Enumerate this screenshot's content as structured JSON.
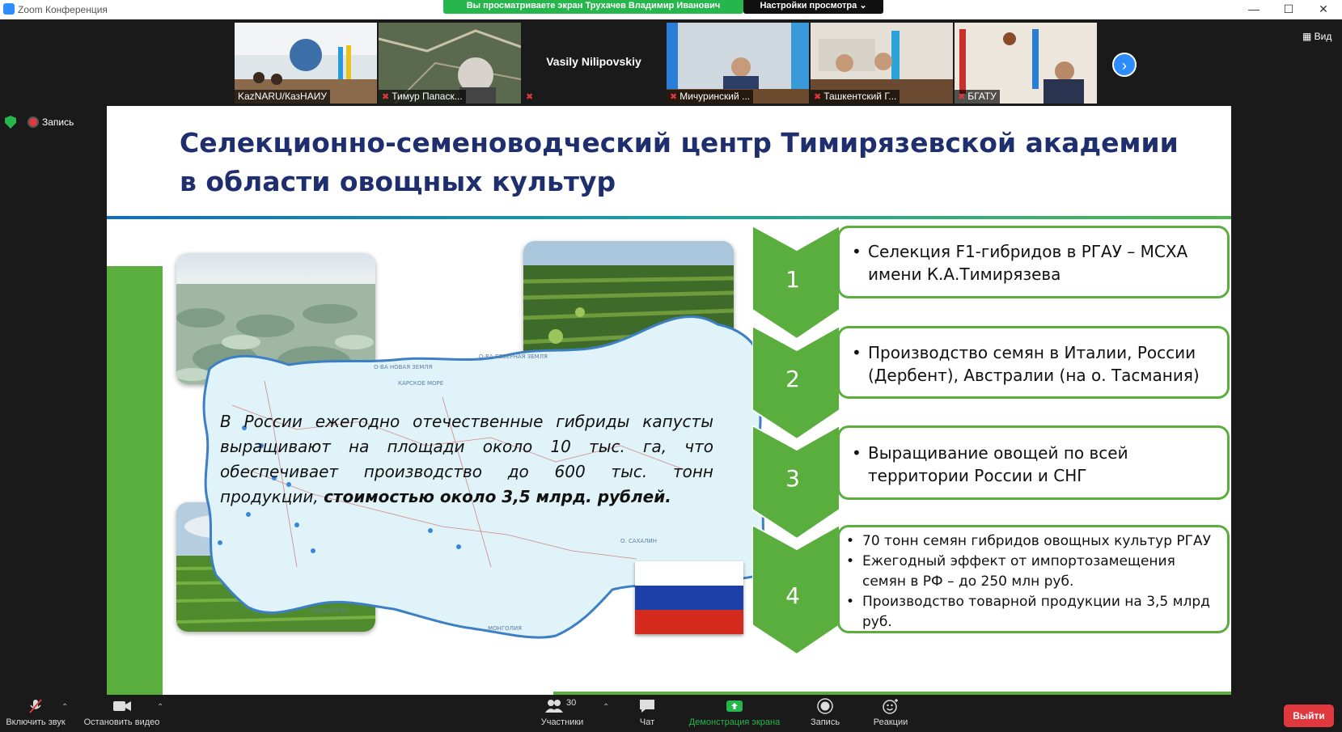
{
  "window": {
    "app_title": "Zoom Конференция",
    "minimize": "—",
    "maximize": "☐",
    "close": "✕"
  },
  "share": {
    "banner": "Вы просматриваете экран Трухачев Владимир Иванович",
    "view_options": "Настройки просмотра ⌄"
  },
  "gallery": {
    "participants": [
      {
        "name": "KazNARU/КазНАИУ",
        "muted": false
      },
      {
        "name": "Тимур Папаск...",
        "muted": true
      },
      {
        "name": "Vasily Nilipovskiy",
        "muted": true
      },
      {
        "name": "Мичуринский ...",
        "muted": true
      },
      {
        "name": "Ташкентский Г...",
        "muted": true
      },
      {
        "name": "БГАТУ",
        "muted": true
      }
    ],
    "next_icon": "›",
    "view_label": "▦ Вид"
  },
  "recording": {
    "label": "Запись"
  },
  "slide": {
    "title_line1": "Селекционно-семеноводческий центр Тимирязевской академии",
    "title_line2": "в области овощных культур",
    "map_text_part1": "В России ежегодно отечественные гибриды капусты выращивают на площади около 10 тыс. га, что обеспечивает производство до 600 тыс. тонн продукции, ",
    "map_text_bold": "стоимостью около 3,5 млрд. рублей.",
    "map_labels": {
      "sea1": "О-ВА НОВАЯ ЗЕМЛЯ",
      "sea2": "КАРСКОЕ МОРЕ",
      "land1": "О-ВА СЕВЕРНАЯ ЗЕМЛЯ",
      "kaz": "КАЗАХСТАН",
      "mong": "МОНГОЛИЯ",
      "sakh": "О. САХАЛИН"
    },
    "steps": [
      {
        "num": "1",
        "items": [
          "Селекция F1-гибридов в РГАУ – МСХА имени К.А.Тимирязева"
        ]
      },
      {
        "num": "2",
        "items": [
          "Производство семян в Италии, России (Дербент), Австралии (на о. Тасмания)"
        ]
      },
      {
        "num": "3",
        "items": [
          "Выращивание овощей по всей территории России и СНГ"
        ]
      },
      {
        "num": "4",
        "items": [
          "70 тонн семян гибридов овощных культур РГАУ",
          "Ежегодный эффект от импортозамещения семян в РФ – до 250 млн руб.",
          "Производство товарной продукции на 3,5 млрд руб."
        ]
      }
    ],
    "colors": {
      "title": "#1f2f6e",
      "accent_green": "#5aae3e",
      "map_fill": "#dff3f8"
    }
  },
  "toolbar": {
    "mute": "Включить звук",
    "video": "Остановить видео",
    "participants": "Участники",
    "participants_count": "30",
    "chat": "Чат",
    "share": "Демонстрация экрана",
    "record": "Запись",
    "reactions": "Реакции",
    "leave": "Выйти"
  }
}
